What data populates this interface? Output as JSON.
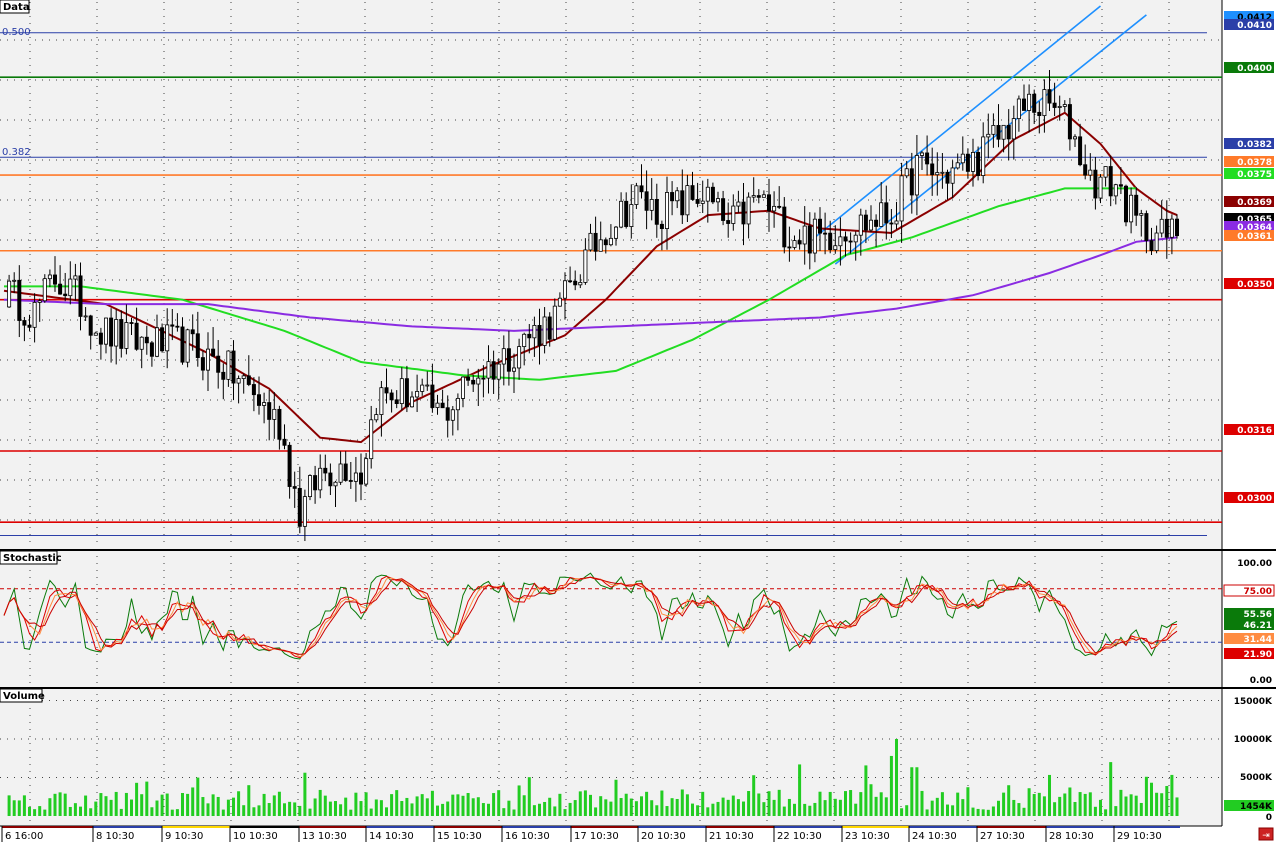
{
  "panels": {
    "price_title": "Data",
    "stoch_title": "Stochastic",
    "volume_title": "Volume"
  },
  "fib_labels": [
    "0.500",
    "0.382"
  ],
  "price_tags": [
    {
      "label": "0.0412",
      "bg": "#1e90ff",
      "fg": "#000000"
    },
    {
      "label": "0.0410",
      "bg": "#2b3fa8",
      "fg": "#ffffff"
    },
    {
      "label": "0.0400",
      "bg": "#0a7a0a",
      "fg": "#ffffff"
    },
    {
      "label": "0.0382",
      "bg": "#2b3fa8",
      "fg": "#ffffff"
    },
    {
      "label": "0.0378",
      "bg": "#ff7a2a",
      "fg": "#ffffff"
    },
    {
      "label": "0.0375",
      "bg": "#22dd22",
      "fg": "#ffffff"
    },
    {
      "label": "0.0369",
      "bg": "#8b0000",
      "fg": "#ffffff"
    },
    {
      "label": "0.0365",
      "bg": "#000000",
      "fg": "#ffffff"
    },
    {
      "label": "0.0364",
      "bg": "#8a2be2",
      "fg": "#ffffff"
    },
    {
      "label": "0.0361",
      "bg": "#ff7a2a",
      "fg": "#ffffff"
    },
    {
      "label": "0.0350",
      "bg": "#dd0000",
      "fg": "#ffffff"
    },
    {
      "label": "0.0316",
      "bg": "#dd0000",
      "fg": "#ffffff"
    },
    {
      "label": "0.0300",
      "bg": "#dd0000",
      "fg": "#ffffff"
    }
  ],
  "stoch_axis": [
    "100.00",
    "0.00"
  ],
  "stoch_tags": [
    {
      "label": "75.00",
      "bg": "#ffffff",
      "fg": "#cc0000"
    },
    {
      "label": "55.56",
      "bg": "#0a7a0a",
      "fg": "#ffffff"
    },
    {
      "label": "46.21",
      "bg": "#0a7a0a",
      "fg": "#ffffff"
    },
    {
      "label": "31.44",
      "bg": "#ff8c42",
      "fg": "#ffffff"
    },
    {
      "label": "21.90",
      "bg": "#dd0000",
      "fg": "#ffffff"
    }
  ],
  "volume_axis": [
    "15000K",
    "10000K",
    "5000K",
    "0"
  ],
  "volume_tag": {
    "label": "1454K",
    "bg": "#22cc22",
    "fg": "#000000"
  },
  "x_labels": [
    "6 16:00",
    "8 10:30",
    "9 10:30",
    "10 10:30",
    "13 10:30",
    "14 10:30",
    "15 10:30",
    "16 10:30",
    "17 10:30",
    "20 10:30",
    "21 10:30",
    "22 10:30",
    "23 10:30",
    "24 10:30",
    "27 10:30",
    "28 10:30",
    "29 10:30"
  ],
  "colors": {
    "panel_bg": "#f2f2f2",
    "candle": "#000000",
    "ma_short": "#8b0000",
    "ma_mid": "#22dd22",
    "ma_long": "#8a2be2",
    "channel": "#1e90ff",
    "fib": "#2b3fa8",
    "support": "#dd0000",
    "resistance_orange": "#ff7a2a",
    "green_level": "#0a7a0a",
    "volume": "#22cc22"
  },
  "chart_data": [
    {
      "type": "line",
      "title": "Data",
      "x_unit": "bar index (about 230 intraday bars)",
      "x_categories": [
        "6 16:00",
        "8 10:30",
        "9 10:30",
        "10 10:30",
        "13 10:30",
        "14 10:30",
        "15 10:30",
        "16 10:30",
        "17 10:30",
        "20 10:30",
        "21 10:30",
        "22 10:30",
        "23 10:30",
        "24 10:30",
        "27 10:30",
        "28 10:30",
        "29 10:30"
      ],
      "ylim": [
        0.0293,
        0.0416
      ],
      "close_anchors": [
        [
          0,
          0.0352
        ],
        [
          6,
          0.0347
        ],
        [
          10,
          0.0355
        ],
        [
          14,
          0.0351
        ],
        [
          19,
          0.0343
        ],
        [
          24,
          0.0341
        ],
        [
          29,
          0.034
        ],
        [
          35,
          0.034
        ],
        [
          42,
          0.0336
        ],
        [
          48,
          0.033
        ],
        [
          54,
          0.0322
        ],
        [
          58,
          0.0302
        ],
        [
          62,
          0.0311
        ],
        [
          67,
          0.0313
        ],
        [
          70,
          0.0311
        ],
        [
          73,
          0.0328
        ],
        [
          80,
          0.0329
        ],
        [
          86,
          0.0324
        ],
        [
          92,
          0.0333
        ],
        [
          97,
          0.0336
        ],
        [
          102,
          0.0341
        ],
        [
          108,
          0.0346
        ],
        [
          113,
          0.0357
        ],
        [
          118,
          0.0366
        ],
        [
          124,
          0.0373
        ],
        [
          128,
          0.037
        ],
        [
          132,
          0.0371
        ],
        [
          137,
          0.0374
        ],
        [
          142,
          0.0366
        ],
        [
          148,
          0.0373
        ],
        [
          154,
          0.0365
        ],
        [
          160,
          0.0364
        ],
        [
          164,
          0.0366
        ],
        [
          168,
          0.0367
        ],
        [
          174,
          0.0369
        ],
        [
          179,
          0.038
        ],
        [
          184,
          0.0378
        ],
        [
          190,
          0.0381
        ],
        [
          196,
          0.0388
        ],
        [
          201,
          0.0394
        ],
        [
          206,
          0.0393
        ],
        [
          209,
          0.0389
        ],
        [
          213,
          0.0377
        ],
        [
          218,
          0.0376
        ],
        [
          222,
          0.0367
        ],
        [
          228,
          0.0364
        ],
        [
          230,
          0.0366
        ]
      ],
      "series": [
        {
          "name": "",
          "role": "short moving average",
          "color": "#8b0000",
          "values": [
            [
              0,
              0.0352
            ],
            [
              20,
              0.0349
            ],
            [
              40,
              0.0338
            ],
            [
              52,
              0.033
            ],
            [
              62,
              0.0319
            ],
            [
              70,
              0.0318
            ],
            [
              80,
              0.0327
            ],
            [
              95,
              0.0335
            ],
            [
              110,
              0.0342
            ],
            [
              118,
              0.035
            ],
            [
              128,
              0.0362
            ],
            [
              138,
              0.0369
            ],
            [
              150,
              0.037
            ],
            [
              160,
              0.0366
            ],
            [
              174,
              0.0365
            ],
            [
              186,
              0.0373
            ],
            [
              198,
              0.0386
            ],
            [
              208,
              0.0392
            ],
            [
              215,
              0.0385
            ],
            [
              222,
              0.0375
            ],
            [
              228,
              0.037
            ],
            [
              230,
              0.0369
            ]
          ]
        },
        {
          "name": "",
          "role": "mid moving average",
          "color": "#22dd22",
          "values": [
            [
              0,
              0.0353
            ],
            [
              15,
              0.0353
            ],
            [
              35,
              0.035
            ],
            [
              55,
              0.0343
            ],
            [
              70,
              0.0336
            ],
            [
              90,
              0.0333
            ],
            [
              105,
              0.0332
            ],
            [
              120,
              0.0334
            ],
            [
              135,
              0.0341
            ],
            [
              150,
              0.035
            ],
            [
              165,
              0.036
            ],
            [
              178,
              0.0364
            ],
            [
              195,
              0.0371
            ],
            [
              208,
              0.0375
            ],
            [
              215,
              0.0375
            ],
            [
              222,
              0.0375
            ]
          ]
        },
        {
          "name": "",
          "role": "long moving average",
          "color": "#8a2be2",
          "values": [
            [
              0,
              0.035
            ],
            [
              20,
              0.0349
            ],
            [
              40,
              0.0349
            ],
            [
              60,
              0.0346
            ],
            [
              80,
              0.0344
            ],
            [
              100,
              0.0343
            ],
            [
              120,
              0.0344
            ],
            [
              140,
              0.0345
            ],
            [
              160,
              0.0346
            ],
            [
              175,
              0.0348
            ],
            [
              190,
              0.0351
            ],
            [
              205,
              0.0356
            ],
            [
              215,
              0.036
            ],
            [
              222,
              0.0363
            ],
            [
              230,
              0.0364
            ]
          ]
        }
      ],
      "horizontal_lines": [
        {
          "value": 0.041,
          "label": "0.500",
          "color": "#2b3fa8"
        },
        {
          "value": 0.04,
          "color": "#0a7a0a"
        },
        {
          "value": 0.0382,
          "label": "0.382",
          "color": "#2b3fa8"
        },
        {
          "value": 0.0378,
          "color": "#ff7a2a"
        },
        {
          "value": 0.0361,
          "color": "#ff7a2a"
        },
        {
          "value": 0.035,
          "color": "#dd0000"
        },
        {
          "value": 0.0316,
          "color": "#dd0000"
        },
        {
          "value": 0.03,
          "color": "#dd0000"
        },
        {
          "value": 0.0297,
          "color": "#2b3fa8"
        }
      ],
      "trend_channel": [
        {
          "from": [
            159,
            0.0364
          ],
          "to": [
            215,
            0.0416
          ],
          "color": "#1e90ff"
        },
        {
          "from": [
            163,
            0.0358
          ],
          "to": [
            224,
            0.0414
          ],
          "color": "#1e90ff"
        }
      ],
      "grid": true,
      "last_close": 0.0365
    },
    {
      "type": "line",
      "title": "Stochastic",
      "ylim": [
        0,
        100
      ],
      "levels": [
        75,
        25
      ],
      "last_values": [
        55.56,
        46.21,
        31.44,
        21.9
      ],
      "grid": true
    },
    {
      "type": "bar",
      "title": "Volume",
      "ylim": [
        0,
        15000
      ],
      "y_unit": "K",
      "last_value": 1454,
      "grid": true
    }
  ]
}
